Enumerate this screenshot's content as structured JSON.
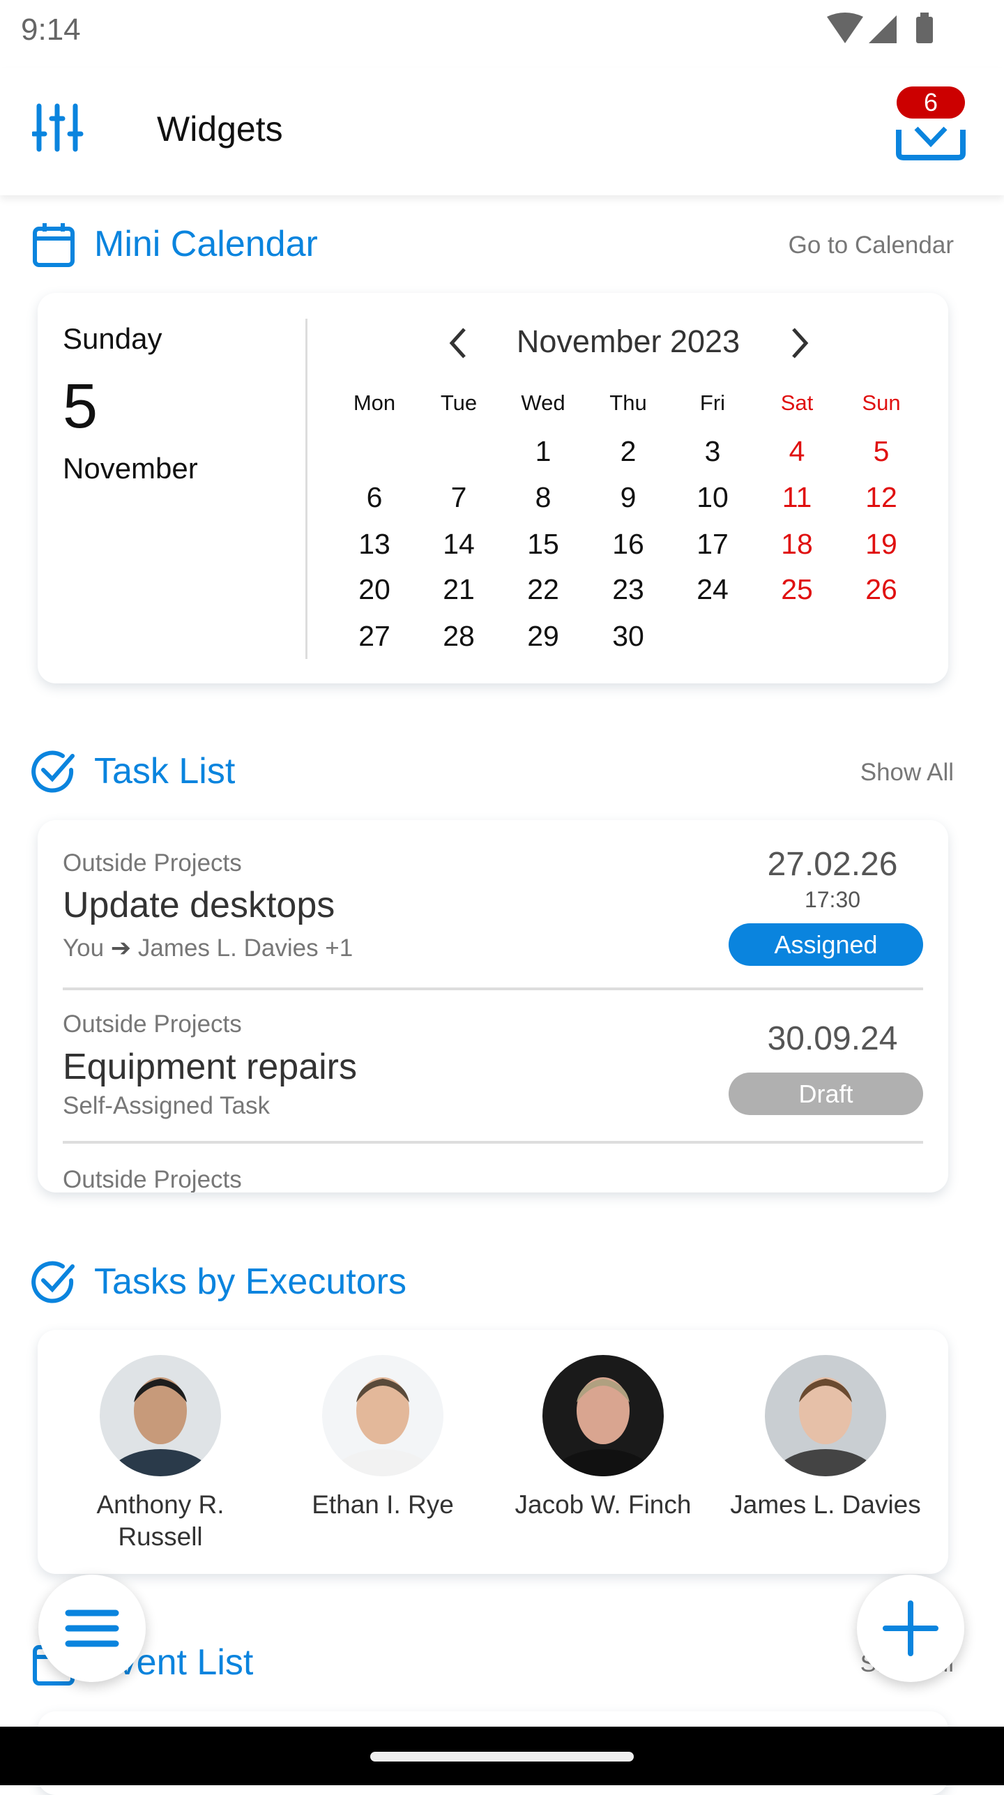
{
  "status_bar": {
    "time": "9:14",
    "icons": [
      "wifi-icon",
      "signal-icon",
      "battery-icon"
    ]
  },
  "app_bar": {
    "title": "Widgets",
    "inbox_badge": "6",
    "left_icon": "sliders-icon",
    "right_icon": "inbox-download-icon"
  },
  "colors": {
    "accent": "#0a84de",
    "weekend": "#e01010",
    "badge": "#cc0000",
    "assigned": "#0a84de",
    "draft": "#b0b0b0"
  },
  "mini_calendar": {
    "title": "Mini Calendar",
    "link": "Go to Calendar",
    "weekday": "Sunday",
    "day": "5",
    "month": "November",
    "month_year": "November 2023",
    "weekdays": [
      "Mon",
      "Tue",
      "Wed",
      "Thu",
      "Fri",
      "Sat",
      "Sun"
    ],
    "weeks": [
      [
        "",
        "",
        "1",
        "2",
        "3",
        "4",
        "5"
      ],
      [
        "6",
        "7",
        "8",
        "9",
        "10",
        "11",
        "12"
      ],
      [
        "13",
        "14",
        "15",
        "16",
        "17",
        "18",
        "19"
      ],
      [
        "20",
        "21",
        "22",
        "23",
        "24",
        "25",
        "26"
      ],
      [
        "27",
        "28",
        "29",
        "30",
        "",
        "",
        ""
      ]
    ]
  },
  "task_list": {
    "title": "Task List",
    "link": "Show All",
    "tasks": [
      {
        "category": "Outside Projects",
        "title": "Update desktops",
        "from": "You",
        "to": "James L. Davies +1",
        "date": "27.02.26",
        "time": "17:30",
        "status": "Assigned"
      },
      {
        "category": "Outside Projects",
        "title": "Equipment repairs",
        "subtitle": "Self-Assigned Task",
        "date": "30.09.24",
        "status": "Draft"
      },
      {
        "category": "Outside Projects"
      }
    ]
  },
  "executors": {
    "title": "Tasks by Executors",
    "people": [
      {
        "name_line1": "Anthony R.",
        "name_line2": "Russell"
      },
      {
        "name_line1": "Ethan I. Rye"
      },
      {
        "name_line1": "Jacob W. Finch"
      },
      {
        "name_line1": "James L. Davies"
      }
    ]
  },
  "event_list": {
    "title": "Event List",
    "link": "Show All"
  }
}
